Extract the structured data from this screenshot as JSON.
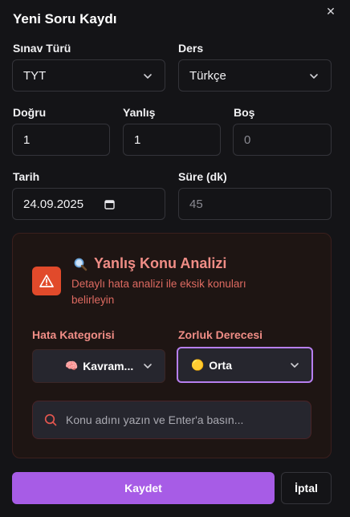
{
  "dialog": {
    "title": "Yeni Soru Kaydı",
    "close_icon": "close-icon"
  },
  "form": {
    "exam_type": {
      "label": "Sınav Türü",
      "value": "TYT"
    },
    "subject": {
      "label": "Ders",
      "value": "Türkçe"
    },
    "correct": {
      "label": "Doğru",
      "value": "1"
    },
    "wrong": {
      "label": "Yanlış",
      "value": "1"
    },
    "empty": {
      "label": "Boş",
      "placeholder": "0"
    },
    "date": {
      "label": "Tarih",
      "value": "24.09.2025"
    },
    "duration": {
      "label": "Süre (dk)",
      "placeholder": "45"
    }
  },
  "analysis": {
    "icon": "warning-icon",
    "title": "Yanlış Konu Analizi",
    "description": "Detaylı hata analizi ile eksik konuları belirleyin",
    "error_category": {
      "label": "Hata Kategorisi",
      "value": "Kavram...",
      "emoji": "🧠"
    },
    "difficulty": {
      "label": "Zorluk Derecesi",
      "value": "Orta",
      "emoji": "🟡"
    },
    "topic_search": {
      "placeholder": "Konu adını yazın ve Enter'a basın..."
    }
  },
  "actions": {
    "save_label": "Kaydet",
    "cancel_label": "İptal"
  },
  "colors": {
    "background": "#141417",
    "accent": "#a75ce6",
    "warning": "#e14a2b",
    "panel_text": "#f08d86"
  }
}
